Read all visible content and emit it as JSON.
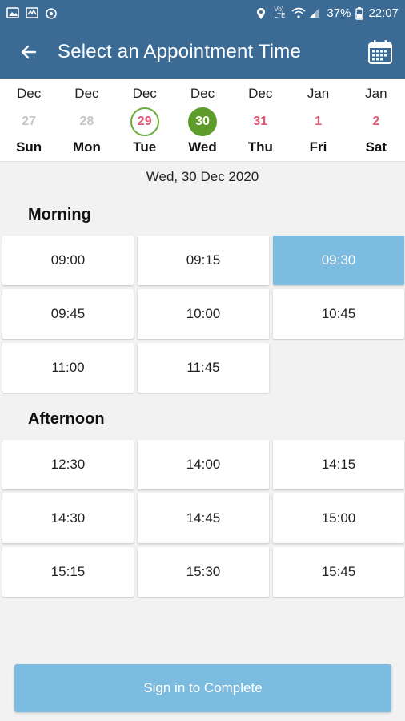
{
  "status_bar": {
    "left_icons": [
      "image-icon",
      "activity-icon",
      "sync-icon"
    ],
    "network_label": "Vo) LTE",
    "battery": "37%",
    "time": "22:07"
  },
  "app_bar": {
    "title": "Select an Appointment Time",
    "back_icon": "back-arrow-icon",
    "calendar_icon": "calendar-icon",
    "color": "#3b6b95"
  },
  "date_strip": {
    "days": [
      {
        "month": "Dec",
        "num": "27",
        "weekday": "Sun",
        "state": "past"
      },
      {
        "month": "Dec",
        "num": "28",
        "weekday": "Mon",
        "state": "past"
      },
      {
        "month": "Dec",
        "num": "29",
        "weekday": "Tue",
        "state": "today"
      },
      {
        "month": "Dec",
        "num": "30",
        "weekday": "Wed",
        "state": "selected"
      },
      {
        "month": "Dec",
        "num": "31",
        "weekday": "Thu",
        "state": "future"
      },
      {
        "month": "Jan",
        "num": "1",
        "weekday": "Fri",
        "state": "future"
      },
      {
        "month": "Jan",
        "num": "2",
        "weekday": "Sat",
        "state": "future"
      }
    ],
    "colors": {
      "today_ring": "#6aac3a",
      "selected_fill": "#5d9c2a",
      "future_text": "#e05a73",
      "past_text": "#c6c6c6"
    }
  },
  "selected_date_label": "Wed, 30 Dec 2020",
  "morning": {
    "title": "Morning",
    "slots": [
      {
        "time": "09:00",
        "selected": false
      },
      {
        "time": "09:15",
        "selected": false
      },
      {
        "time": "09:30",
        "selected": true
      },
      {
        "time": "09:45",
        "selected": false
      },
      {
        "time": "10:00",
        "selected": false
      },
      {
        "time": "10:45",
        "selected": false
      },
      {
        "time": "11:00",
        "selected": false
      },
      {
        "time": "11:45",
        "selected": false
      }
    ]
  },
  "afternoon": {
    "title": "Afternoon",
    "slots": [
      {
        "time": "12:30",
        "selected": false
      },
      {
        "time": "14:00",
        "selected": false
      },
      {
        "time": "14:15",
        "selected": false
      },
      {
        "time": "14:30",
        "selected": false
      },
      {
        "time": "14:45",
        "selected": false
      },
      {
        "time": "15:00",
        "selected": false
      },
      {
        "time": "15:15",
        "selected": false
      },
      {
        "time": "15:30",
        "selected": false
      },
      {
        "time": "15:45",
        "selected": false
      }
    ]
  },
  "cta": {
    "label": "Sign in to Complete",
    "color": "#7bbce0"
  }
}
